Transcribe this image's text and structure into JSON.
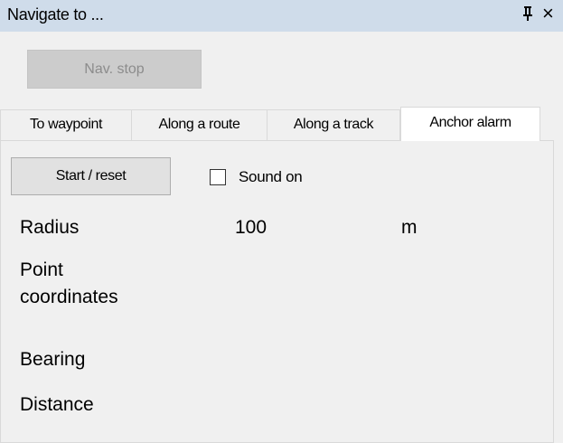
{
  "window": {
    "title": "Navigate to ...",
    "pin_glyph": "q",
    "close_glyph": "×"
  },
  "toolbar": {
    "nav_stop_label": "Nav. stop"
  },
  "tabs": [
    {
      "label": "To waypoint",
      "active": false
    },
    {
      "label": "Along a route",
      "active": false
    },
    {
      "label": "Along a track",
      "active": false
    },
    {
      "label": "Anchor alarm",
      "active": true
    }
  ],
  "anchor_alarm": {
    "start_reset_label": "Start / reset",
    "sound_on_label": "Sound on",
    "sound_on_checked": false,
    "radius_label": "Radius",
    "radius_value": "100",
    "radius_unit": "m",
    "point_coordinates_label_line1": "Point",
    "point_coordinates_label_line2": "coordinates",
    "bearing_label": "Bearing",
    "distance_label": "Distance"
  },
  "colors": {
    "titlebar_bg": "#cfdcea",
    "window_bg": "#f0f0f0",
    "disabled_text": "#8c8c8c"
  }
}
